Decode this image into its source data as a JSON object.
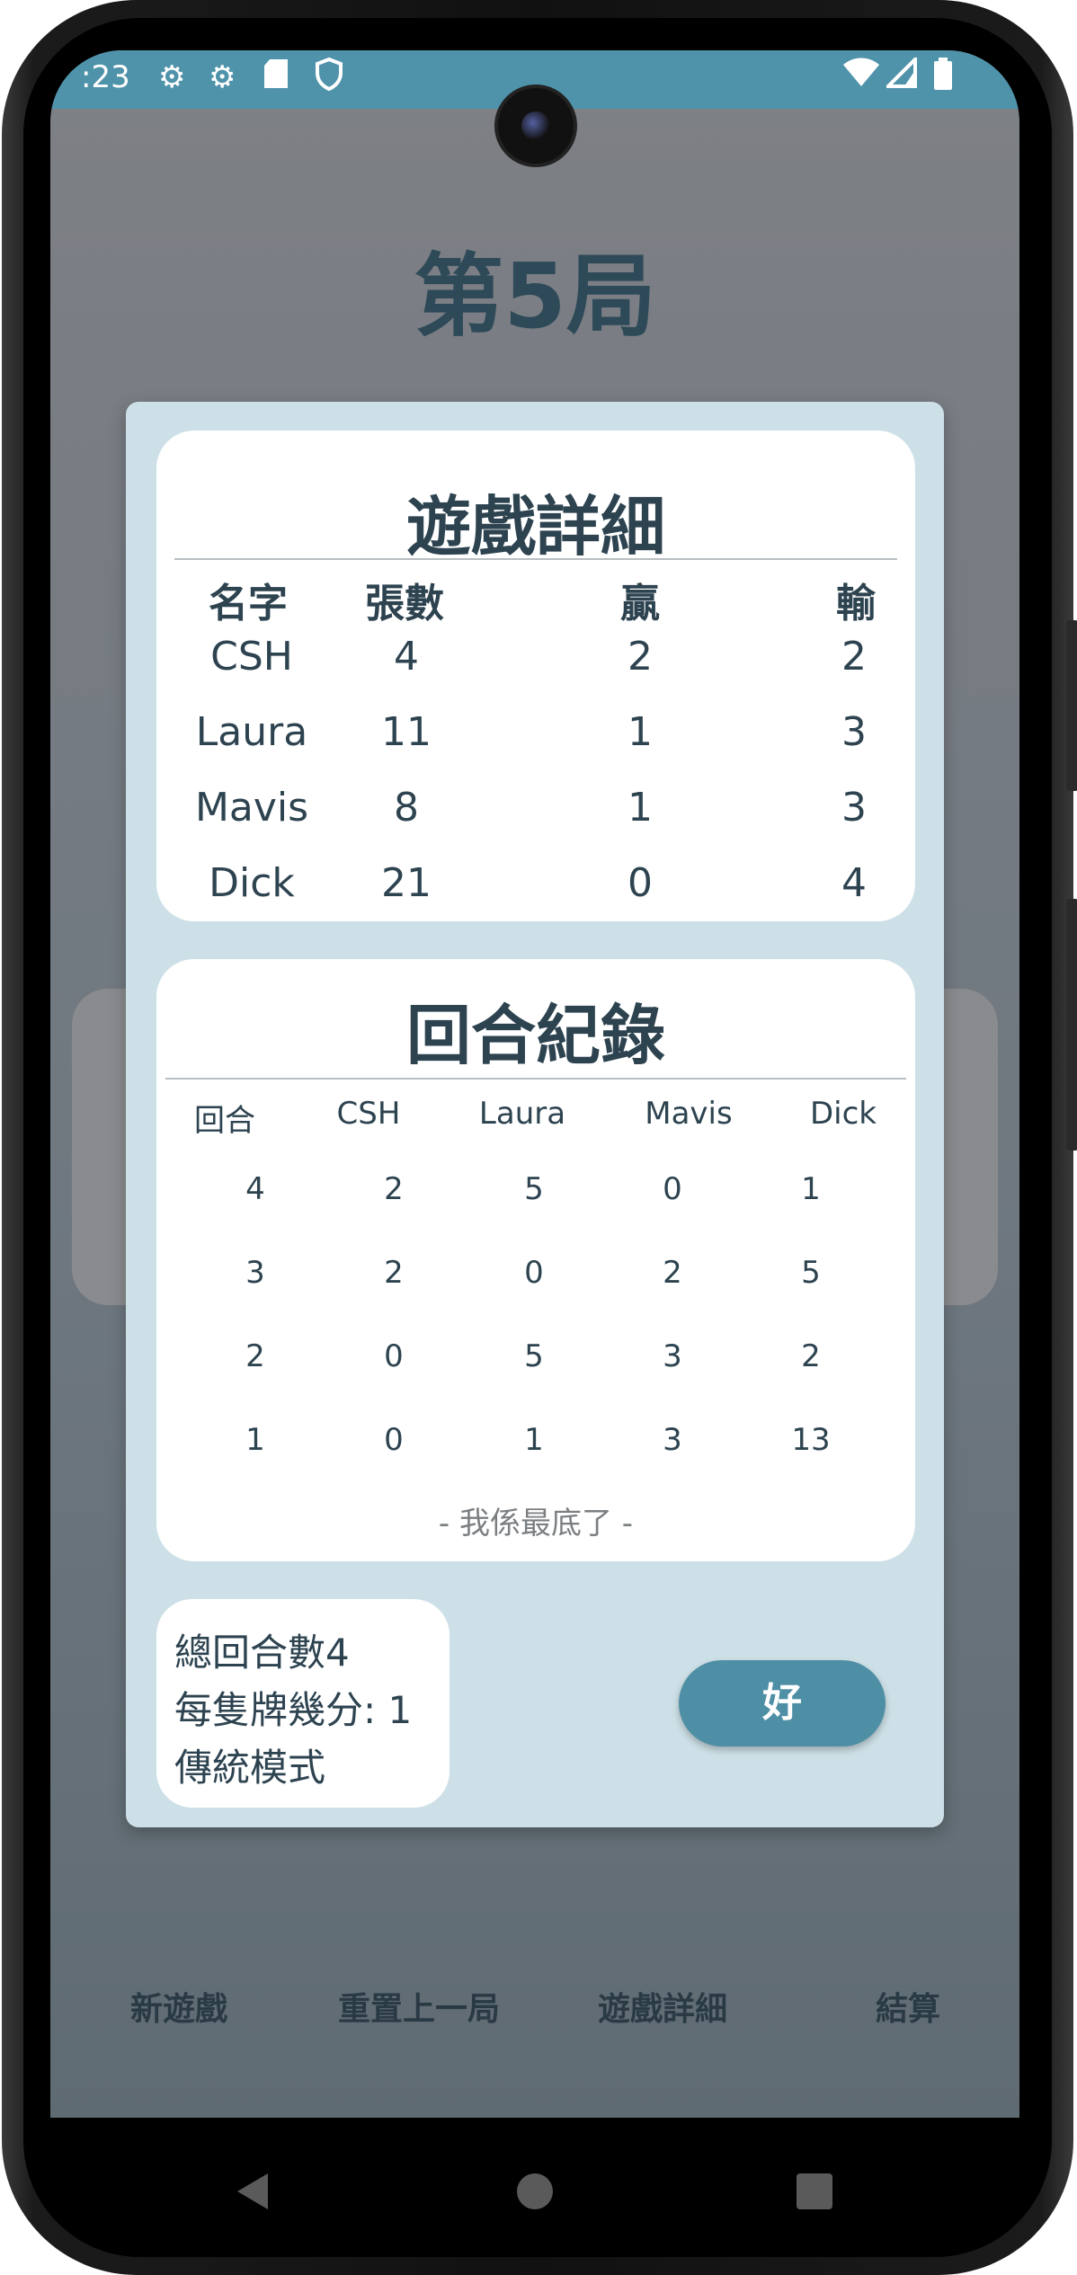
{
  "status_bar": {
    "time": ":23",
    "icons": [
      "gear-icon",
      "gear-icon",
      "sd-card-icon",
      "shield-icon",
      "wifi-icon",
      "signal-icon",
      "battery-icon"
    ]
  },
  "app": {
    "round_title": "第5局"
  },
  "modal": {
    "details": {
      "title": "遊戲詳細",
      "headers": [
        "名字",
        "張數",
        "贏",
        "輸"
      ],
      "rows": [
        [
          "CSH",
          "4",
          "2",
          "2"
        ],
        [
          "Laura",
          "11",
          "1",
          "3"
        ],
        [
          "Mavis",
          "8",
          "1",
          "3"
        ],
        [
          "Dick",
          "21",
          "0",
          "4"
        ]
      ]
    },
    "records": {
      "title": "回合紀錄",
      "headers": [
        "回合",
        "CSH",
        "Laura",
        "Mavis",
        "Dick"
      ],
      "rows": [
        [
          "4",
          "2",
          "5",
          "0",
          "1"
        ],
        [
          "3",
          "2",
          "0",
          "2",
          "5"
        ],
        [
          "2",
          "0",
          "5",
          "3",
          "2"
        ],
        [
          "1",
          "0",
          "1",
          "3",
          "13"
        ]
      ],
      "end_note": "- 我係最底了 -"
    },
    "summary": {
      "total_rounds": "總回合數4",
      "points_per_card": "每隻牌幾分: 1",
      "mode": "傳統模式"
    },
    "ok_label": "好"
  },
  "bottom_nav": {
    "items": [
      "新遊戲",
      "重置上一局",
      "遊戲詳細",
      "結算"
    ]
  },
  "colors": {
    "accent": "#4e8fa5",
    "status_bar": "#4f93aa",
    "modal_bg": "#cde0e7",
    "text_dark": "#2d4350"
  }
}
